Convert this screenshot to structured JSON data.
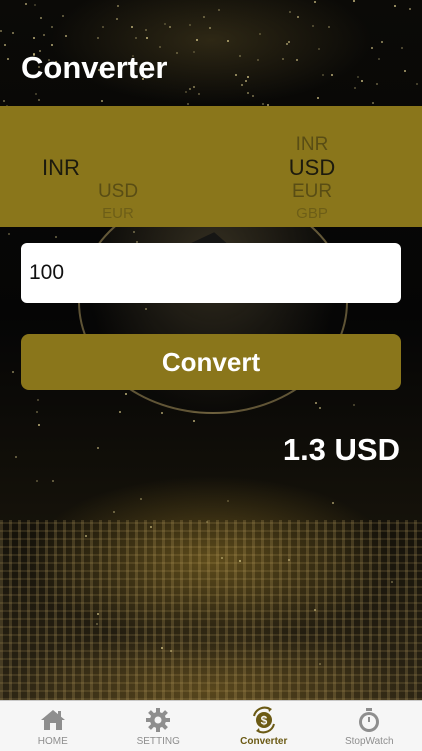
{
  "header": {
    "title": "Converter"
  },
  "picker": {
    "from": {
      "above": "",
      "selected": "INR",
      "below1": "USD",
      "below2": "EUR"
    },
    "to": {
      "above": "INR",
      "selected": "USD",
      "below1": "EUR",
      "below2": "GBP"
    }
  },
  "amount_input": {
    "value": "100"
  },
  "convert_button": {
    "label": "Convert"
  },
  "result": {
    "text": "1.3 USD"
  },
  "tabbar": {
    "tabs": [
      {
        "label": "HOME",
        "icon": "home-icon"
      },
      {
        "label": "SETTING",
        "icon": "gear-icon"
      },
      {
        "label": "Converter",
        "icon": "currency-exchange-icon",
        "active": true
      },
      {
        "label": "StopWatch",
        "icon": "stopwatch-icon"
      }
    ]
  },
  "colors": {
    "accent": "#8a761b",
    "active_tab": "#6b5a14"
  }
}
